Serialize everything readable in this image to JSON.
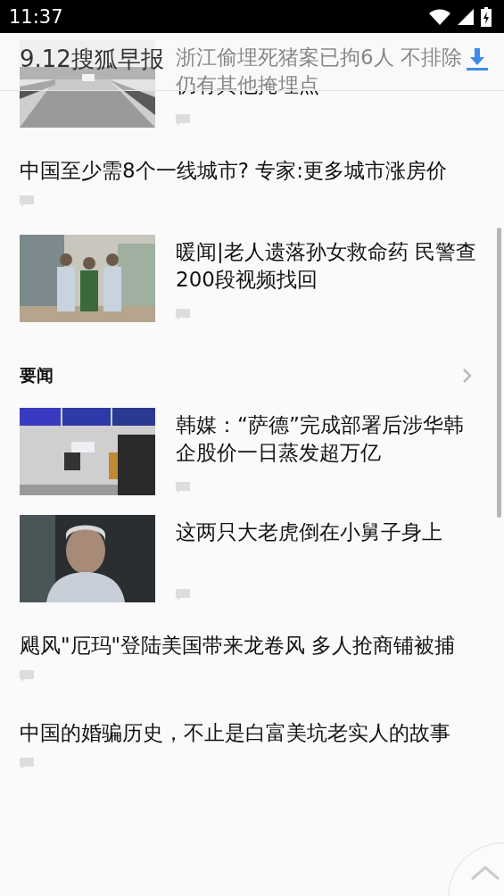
{
  "status_bar": {
    "time": "11:37"
  },
  "header": {
    "title": "9.12搜狐早报"
  },
  "feed": [
    {
      "kind": "image_article",
      "title": "浙江偷埋死猪案已拘6人 不排除仍有其他掩埋点"
    },
    {
      "kind": "text_article",
      "title": "中国至少需8个一线城市? 专家:更多城市涨房价"
    },
    {
      "kind": "image_article",
      "title": "暖闻|老人遗落孙女救命药 民警查200段视频找回"
    },
    {
      "kind": "section",
      "title": "要闻"
    },
    {
      "kind": "image_article",
      "title": "韩媒：“萨德”完成部署后涉华韩企股价一日蒸发超万亿"
    },
    {
      "kind": "image_article",
      "title": "这两只大老虎倒在小舅子身上"
    },
    {
      "kind": "text_article",
      "title": "飓风\"厄玛\"登陆美国带来龙卷风 多人抢商铺被捕"
    },
    {
      "kind": "text_article",
      "title": "中国的婚骗历史，不止是白富美坑老实人的故事"
    }
  ]
}
